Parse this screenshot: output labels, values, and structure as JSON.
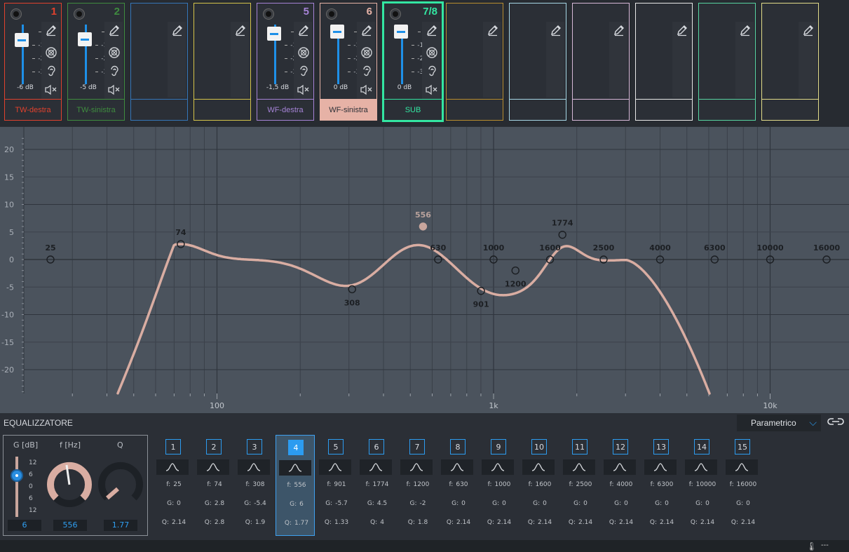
{
  "channels": [
    {
      "num": "1",
      "name": "TW-destra",
      "db": "-6 dB",
      "color": "#e0412d",
      "fader": 0.55,
      "has_fader": true
    },
    {
      "num": "2",
      "name": "TW-sinistra",
      "db": "-5 dB",
      "color": "#3f8c3f",
      "fader": 0.57,
      "has_fader": true
    },
    {
      "num": "",
      "name": "",
      "db": "",
      "color": "#3576b8",
      "has_fader": false
    },
    {
      "num": "",
      "name": "",
      "db": "",
      "color": "#d4c34a",
      "has_fader": false
    },
    {
      "num": "5",
      "name": "WF-destra",
      "db": "-1,5 dB",
      "color": "#a583d6",
      "fader": 0.9,
      "has_fader": true
    },
    {
      "num": "6",
      "name": "WF-sinistra",
      "db": "0 dB",
      "color": "#e6b2a6",
      "fader": 1.0,
      "has_fader": true,
      "name_filled": true
    },
    {
      "num": "7/8",
      "name": "SUB",
      "db": "0 dB",
      "color": "#33e6a2",
      "fader": 1.0,
      "has_fader": true,
      "selected": true
    },
    {
      "num": "",
      "name": "",
      "db": "",
      "color": "#b88d2e",
      "has_fader": false
    },
    {
      "num": "",
      "name": "",
      "db": "",
      "color": "#a7d7e6",
      "has_fader": false
    },
    {
      "num": "",
      "name": "",
      "db": "",
      "color": "#d7b8d8",
      "has_fader": false
    },
    {
      "num": "",
      "name": "",
      "db": "",
      "color": "#e8e8e8",
      "has_fader": false
    },
    {
      "num": "",
      "name": "",
      "db": "",
      "color": "#57d4a1",
      "has_fader": false
    },
    {
      "num": "",
      "name": "",
      "db": "",
      "color": "#e2dc8a",
      "has_fader": false
    }
  ],
  "fader_scale": [
    "0",
    "-12",
    "-24",
    "-36"
  ],
  "icons": {
    "edit": "pencil-icon",
    "phase": "phase-icon",
    "listen": "ear-icon",
    "mute": "mute-speaker-icon"
  },
  "graph": {
    "y_ticks": [
      "20",
      "15",
      "10",
      "5",
      "0",
      "-5",
      "-10",
      "-15",
      "-20"
    ],
    "x_ticks": [
      "100",
      "1k",
      "10k"
    ],
    "ylim": [
      -24,
      20
    ],
    "curve_color": "#d9ada2",
    "points": [
      {
        "f": 25,
        "g": 0,
        "label": "25"
      },
      {
        "f": 74,
        "g": 2.8,
        "label": "74"
      },
      {
        "f": 308,
        "g": -5.4,
        "label": "308"
      },
      {
        "f": 556,
        "g": 6,
        "label": "556",
        "active": true
      },
      {
        "f": 630,
        "g": 0,
        "label": "630"
      },
      {
        "f": 901,
        "g": -5.7,
        "label": "901"
      },
      {
        "f": 1000,
        "g": 0,
        "label": "1000"
      },
      {
        "f": 1200,
        "g": -2,
        "label": "1200"
      },
      {
        "f": 1600,
        "g": 0,
        "label": "1600"
      },
      {
        "f": 1774,
        "g": 4.5,
        "label": "1774"
      },
      {
        "f": 2500,
        "g": 0,
        "label": "2500"
      },
      {
        "f": 4000,
        "g": 0,
        "label": "4000"
      },
      {
        "f": 6300,
        "g": 0,
        "label": "6300"
      },
      {
        "f": 10000,
        "g": 0,
        "label": "10000"
      },
      {
        "f": 16000,
        "g": 0,
        "label": "16000"
      }
    ]
  },
  "eq": {
    "title": "EQUALIZZATORE",
    "mode": "Parametrico",
    "g_label": "G [dB]",
    "f_label": "f [Hz]",
    "q_label": "Q",
    "g_scale": [
      "12",
      "6",
      "0",
      "6",
      "12"
    ],
    "g_value": "6",
    "f_value": "556",
    "q_value": "1.77",
    "bands": [
      {
        "n": "1",
        "f": "25",
        "g": "0",
        "q": "2.14"
      },
      {
        "n": "2",
        "f": "74",
        "g": "2.8",
        "q": "2.8"
      },
      {
        "n": "3",
        "f": "308",
        "g": "-5.4",
        "q": "1.9"
      },
      {
        "n": "4",
        "f": "556",
        "g": "6",
        "q": "1.77",
        "active": true
      },
      {
        "n": "5",
        "f": "901",
        "g": "-5.7",
        "q": "1.33"
      },
      {
        "n": "6",
        "f": "1774",
        "g": "4.5",
        "q": "4"
      },
      {
        "n": "7",
        "f": "1200",
        "g": "-2",
        "q": "1.8"
      },
      {
        "n": "8",
        "f": "630",
        "g": "0",
        "q": "2.14"
      },
      {
        "n": "9",
        "f": "1000",
        "g": "0",
        "q": "2.14"
      },
      {
        "n": "10",
        "f": "1600",
        "g": "0",
        "q": "2.14"
      },
      {
        "n": "11",
        "f": "2500",
        "g": "0",
        "q": "2.14"
      },
      {
        "n": "12",
        "f": "4000",
        "g": "0",
        "q": "2.14"
      },
      {
        "n": "13",
        "f": "6300",
        "g": "0",
        "q": "2.14"
      },
      {
        "n": "14",
        "f": "10000",
        "g": "0",
        "q": "2.14"
      },
      {
        "n": "15",
        "f": "16000",
        "g": "0",
        "q": "2.14"
      }
    ],
    "labels": {
      "f": "f:",
      "g": "G:",
      "q": "Q:"
    }
  },
  "status": {
    "temp": "---"
  }
}
